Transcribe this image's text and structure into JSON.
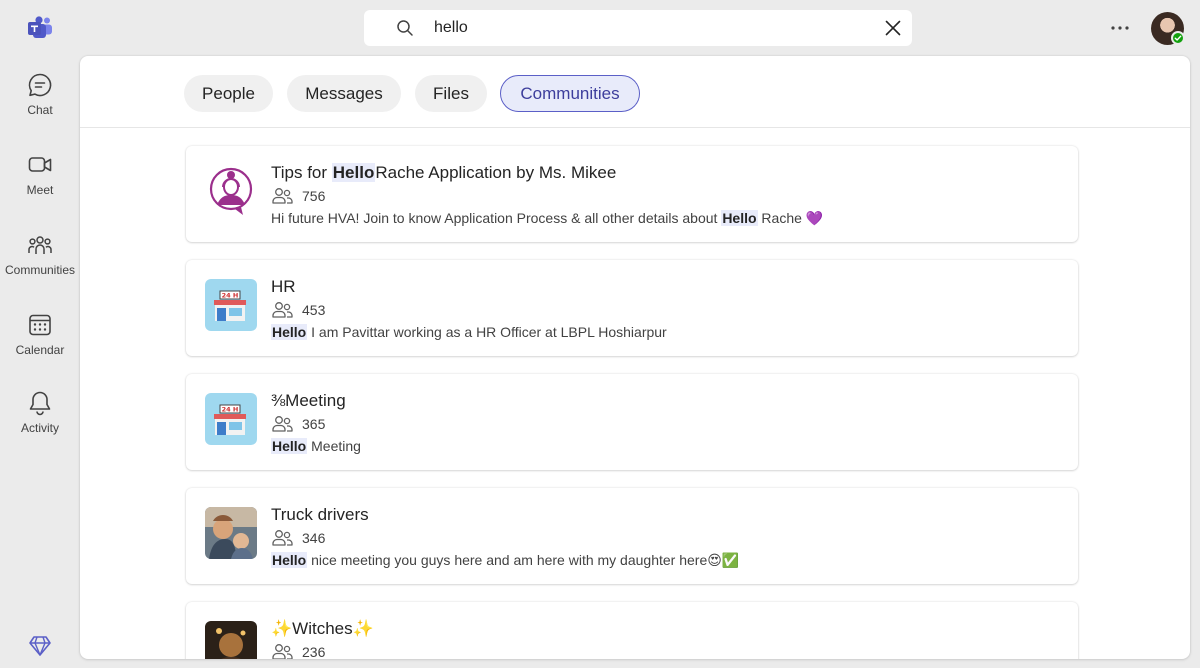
{
  "rail": {
    "items": [
      {
        "label": "Chat",
        "icon": "chat-icon"
      },
      {
        "label": "Meet",
        "icon": "video-camera-icon"
      },
      {
        "label": "Communities",
        "icon": "communities-icon"
      },
      {
        "label": "Calendar",
        "icon": "calendar-icon"
      },
      {
        "label": "Activity",
        "icon": "bell-icon"
      }
    ]
  },
  "search": {
    "value": "hello"
  },
  "tabs": [
    {
      "label": "People"
    },
    {
      "label": "Messages"
    },
    {
      "label": "Files"
    },
    {
      "label": "Communities"
    }
  ],
  "results": [
    {
      "title_pre": "Tips for ",
      "title_hl": "Hello",
      "title_post": "Rache Application by Ms. Mikee",
      "members": "756",
      "desc_pre": "Hi future HVA! Join to know Application Process & all other details about ",
      "desc_hl": "Hello",
      "desc_post": " Rache 💜"
    },
    {
      "title_pre": "HR",
      "title_hl": "",
      "title_post": "",
      "members": "453",
      "desc_pre": "",
      "desc_hl": "Hello",
      "desc_post": " I am Pavittar working as a HR Officer at LBPL Hoshiarpur"
    },
    {
      "title_pre": "⅜Meeting",
      "title_hl": "",
      "title_post": "",
      "members": "365",
      "desc_pre": "",
      "desc_hl": "Hello",
      "desc_post": " Meeting"
    },
    {
      "title_pre": "Truck drivers",
      "title_hl": "",
      "title_post": "",
      "members": "346",
      "desc_pre": "",
      "desc_hl": "Hello",
      "desc_post": " nice meeting you guys here and am here with my daughter here😍✅"
    },
    {
      "title_pre": "✨Witches✨",
      "title_hl": "",
      "title_post": "",
      "members": "236",
      "desc_pre": "",
      "desc_hl": "",
      "desc_post": ""
    }
  ],
  "colors": {
    "accent": "#5b5fc7",
    "accent_bg": "#e8ebfa",
    "presence_available": "#13a10e"
  }
}
